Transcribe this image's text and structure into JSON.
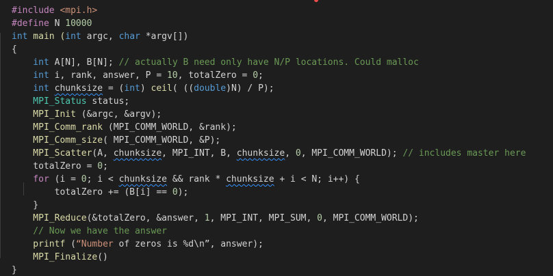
{
  "colors": {
    "background": "#1e1e1e",
    "text": "#d4d4d4",
    "keyword": "#569cd6",
    "type": "#4ec9b0",
    "function": "#dcdcaa",
    "number": "#b5cea8",
    "comment": "#6a9955",
    "string": "#ce9178",
    "squiggle": "#3794ff"
  },
  "code": {
    "lines": [
      {
        "tokens": [
          {
            "text": "#include ",
            "cls": "pp"
          },
          {
            "text": "<mpi.h>",
            "cls": "str"
          }
        ]
      },
      {
        "tokens": [
          {
            "text": "#define ",
            "cls": "pp"
          },
          {
            "text": "N ",
            "cls": "pt"
          },
          {
            "text": "10000",
            "cls": "num"
          }
        ]
      },
      {
        "tokens": [
          {
            "text": "int",
            "cls": "kw"
          },
          {
            "text": " main (",
            "cls": "fn"
          },
          {
            "text": "int",
            "cls": "kw"
          },
          {
            "text": " argc, ",
            "cls": "pt"
          },
          {
            "text": "char",
            "cls": "kw"
          },
          {
            "text": " *argv[])",
            "cls": "pt"
          }
        ]
      },
      {
        "tokens": [
          {
            "text": "{",
            "cls": "pt"
          }
        ]
      },
      {
        "tokens": [
          {
            "text": "    int",
            "cls": "kw"
          },
          {
            "text": " A[N], B[N]; ",
            "cls": "pt"
          },
          {
            "text": "// actually B need only have N/P locations. Could malloc",
            "cls": "cm"
          }
        ]
      },
      {
        "tokens": [
          {
            "text": "    int",
            "cls": "kw"
          },
          {
            "text": " i, rank, answer, P = ",
            "cls": "pt"
          },
          {
            "text": "10",
            "cls": "num"
          },
          {
            "text": ", totalZero = ",
            "cls": "pt"
          },
          {
            "text": "0",
            "cls": "num"
          },
          {
            "text": ";",
            "cls": "pt"
          }
        ]
      },
      {
        "tokens": [
          {
            "text": "    int",
            "cls": "kw"
          },
          {
            "text": " ",
            "cls": "pt"
          },
          {
            "text": "chunksize",
            "cls": "pt",
            "squig": true
          },
          {
            "text": " = (",
            "cls": "pt"
          },
          {
            "text": "int",
            "cls": "kw"
          },
          {
            "text": ") ",
            "cls": "pt"
          },
          {
            "text": "ceil",
            "cls": "fn"
          },
          {
            "text": "( ((",
            "cls": "pt"
          },
          {
            "text": "double",
            "cls": "kw"
          },
          {
            "text": ")N) / P);",
            "cls": "pt"
          }
        ]
      },
      {
        "tokens": [
          {
            "text": "    MPI_Status",
            "cls": "ty"
          },
          {
            "text": " status;",
            "cls": "pt"
          }
        ]
      },
      {
        "tokens": [
          {
            "text": "    MPI_Init",
            "cls": "fn"
          },
          {
            "text": " (&argc, &argv);",
            "cls": "pt"
          }
        ]
      },
      {
        "tokens": [
          {
            "text": "    MPI_Comm_rank",
            "cls": "fn"
          },
          {
            "text": " (MPI_COMM_WORLD, &rank);",
            "cls": "pt"
          }
        ]
      },
      {
        "tokens": [
          {
            "text": "    MPI_Comm_size",
            "cls": "fn"
          },
          {
            "text": "( MPI_COMM_WORLD, &P);",
            "cls": "pt"
          }
        ]
      },
      {
        "tokens": [
          {
            "text": "    MPI_Scatter",
            "cls": "fn"
          },
          {
            "text": "(A, ",
            "cls": "pt"
          },
          {
            "text": "chunksize",
            "cls": "pt",
            "squig": true
          },
          {
            "text": ", MPI_INT, B, ",
            "cls": "pt"
          },
          {
            "text": "chunksize",
            "cls": "pt",
            "squig": true
          },
          {
            "text": ", ",
            "cls": "pt"
          },
          {
            "text": "0",
            "cls": "num"
          },
          {
            "text": ", MPI_COMM_WORLD); ",
            "cls": "pt"
          },
          {
            "text": "// includes master here",
            "cls": "cm"
          }
        ]
      },
      {
        "tokens": [
          {
            "text": "    totalZero = ",
            "cls": "pt"
          },
          {
            "text": "0",
            "cls": "num"
          },
          {
            "text": ";",
            "cls": "pt"
          }
        ]
      },
      {
        "tokens": [
          {
            "text": "    for",
            "cls": "pp"
          },
          {
            "text": " (i = ",
            "cls": "pt"
          },
          {
            "text": "0",
            "cls": "num"
          },
          {
            "text": "; i < ",
            "cls": "pt"
          },
          {
            "text": "chunksize",
            "cls": "pt",
            "squig": true
          },
          {
            "text": " && rank * ",
            "cls": "pt"
          },
          {
            "text": "chunksize",
            "cls": "pt",
            "squig": true
          },
          {
            "text": " + i < N; i++) {",
            "cls": "pt"
          }
        ]
      },
      {
        "tokens": [
          {
            "text": "        totalZero += (B[i] == ",
            "cls": "pt"
          },
          {
            "text": "0",
            "cls": "num"
          },
          {
            "text": ");",
            "cls": "pt"
          }
        ]
      },
      {
        "tokens": [
          {
            "text": "    }",
            "cls": "pt"
          }
        ]
      },
      {
        "tokens": [
          {
            "text": "    MPI_Reduce",
            "cls": "fn"
          },
          {
            "text": "(&totalZero, &answer, ",
            "cls": "pt"
          },
          {
            "text": "1",
            "cls": "num"
          },
          {
            "text": ", MPI_INT, MPI_SUM, ",
            "cls": "pt"
          },
          {
            "text": "0",
            "cls": "num"
          },
          {
            "text": ", MPI_COMM_WORLD);",
            "cls": "pt"
          }
        ]
      },
      {
        "tokens": [
          {
            "text": "    // Now we have the answer",
            "cls": "cm"
          }
        ]
      },
      {
        "tokens": [
          {
            "text": "    printf",
            "cls": "fn"
          },
          {
            "text": " (",
            "cls": "pt"
          },
          {
            "text": "“Number",
            "cls": "str"
          },
          {
            "text": " of zeros is %d\\n”, answer);",
            "cls": "pt"
          }
        ]
      },
      {
        "tokens": [
          {
            "text": "    MPI_Finalize",
            "cls": "fn"
          },
          {
            "text": "()",
            "cls": "pt"
          }
        ]
      },
      {
        "tokens": [
          {
            "text": "}",
            "cls": "pt"
          }
        ]
      }
    ]
  }
}
